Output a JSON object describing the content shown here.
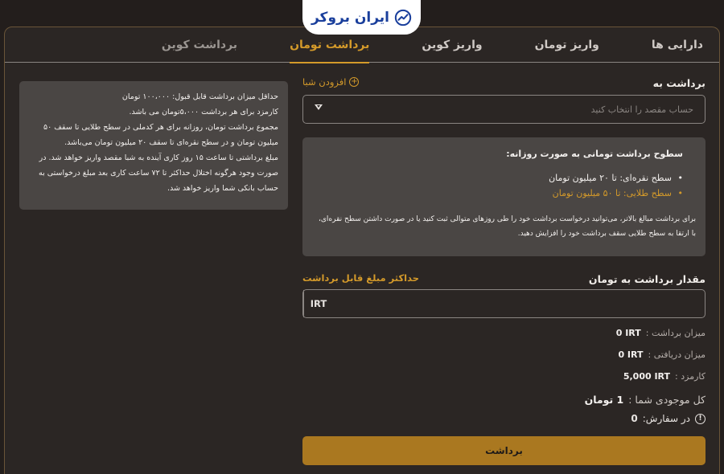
{
  "brand": {
    "name": "ایران بروکر"
  },
  "tabs": [
    {
      "label": "دارایی ها"
    },
    {
      "label": "واریز تومان"
    },
    {
      "label": "واریز کوین"
    },
    {
      "label": "برداشت تومان",
      "active": true
    },
    {
      "label": "برداشت کوین"
    }
  ],
  "info_box": {
    "lines": [
      "حداقل میزان برداشت قابل قبول: ۱۰۰،۰۰۰ تومان",
      "کارمزد برای هر برداشت ۵،۰۰۰تومان می باشد.",
      "مجموع برداشت تومان، روزانه برای هر کدملی در سطح طلایی تا سقف ۵۰ میلیون تومان و در سطح نقره‌ای تا سقف ۲۰ میلیون تومان می‌باشد.",
      "مبلغ برداشتی تا ساعت ۱۵ روز کاری آینده به شبا مقصد واریز خواهد شد. در صورت وجود هرگونه اختلال حداکثر تا ۷۲ ساعت کاری بعد مبلغ درخواستی به حساب بانکی شما واریز خواهد شد."
    ]
  },
  "form": {
    "withdraw_to_label": "برداشت به",
    "add_sheba_label": "افزودن شبا",
    "select_placeholder": "حساب مقصد را انتخاب کنید",
    "levels": {
      "title": "سطوح برداشت تومانی به صورت روزانه:",
      "silver": "سطح نقره‌ای: تا ۲۰ میلیون تومان",
      "gold": "سطح طلایی: تا ۵۰ میلیون تومان",
      "note": "برای برداشت مبالغ بالاتر، می‌توانید درخواست برداشت خود را طی روزهای متوالی ثبت کنید یا در صورت داشتن سطح نقره‌ای، با ارتقا به سطح طلایی سقف برداشت خود را افزایش دهید."
    },
    "amount_label": "مقدار برداشت به تومان",
    "max_amount_label": "حداکثر مبلغ قابل برداشت",
    "amount_value": "",
    "unit": "IRT",
    "stats": [
      {
        "label": "میزان برداشت :",
        "value": "0 IRT"
      },
      {
        "label": "میزان دریافتی :",
        "value": "0 IRT"
      },
      {
        "label": "کارمزد :",
        "value": "5,000 IRT"
      }
    ],
    "balance_label": "کل موجودی شما :",
    "balance_value": "1 تومان",
    "in_order_label": "در سفارش:",
    "in_order_value": "0",
    "submit_label": "برداشت"
  },
  "colors": {
    "accent": "#d49a2a",
    "button": "#aa7820",
    "background": "#231e1c",
    "panel": "#4a4644"
  }
}
